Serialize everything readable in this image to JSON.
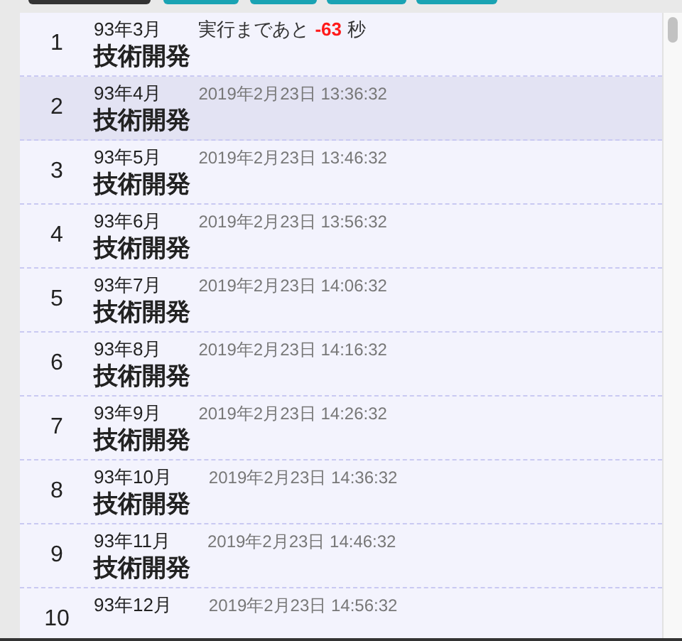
{
  "top_buttons": [
    {
      "color": "#333333"
    },
    {
      "color": "#1aa3b3"
    },
    {
      "color": "#1aa3b3"
    },
    {
      "color": "#1aa3b3"
    },
    {
      "color": "#1aa3b3"
    }
  ],
  "rows": [
    {
      "number": "1",
      "month": "93年3月",
      "kind": "countdown",
      "prefix": "実行まであと",
      "value": "-63",
      "suffix": "秒",
      "title": "技術開発",
      "selected": false
    },
    {
      "number": "2",
      "month": "93年4月",
      "kind": "date",
      "time": "2019年2月23日 13:36:32",
      "title": "技術開発",
      "selected": true
    },
    {
      "number": "3",
      "month": "93年5月",
      "kind": "date",
      "time": "2019年2月23日 13:46:32",
      "title": "技術開発",
      "selected": false
    },
    {
      "number": "4",
      "month": "93年6月",
      "kind": "date",
      "time": "2019年2月23日 13:56:32",
      "title": "技術開発",
      "selected": false
    },
    {
      "number": "5",
      "month": "93年7月",
      "kind": "date",
      "time": "2019年2月23日 14:06:32",
      "title": "技術開発",
      "selected": false
    },
    {
      "number": "6",
      "month": "93年8月",
      "kind": "date",
      "time": "2019年2月23日 14:16:32",
      "title": "技術開発",
      "selected": false
    },
    {
      "number": "7",
      "month": "93年9月",
      "kind": "date",
      "time": "2019年2月23日 14:26:32",
      "title": "技術開発",
      "selected": false
    },
    {
      "number": "8",
      "month": "93年10月",
      "kind": "date",
      "time": "2019年2月23日 14:36:32",
      "title": "技術開発",
      "selected": false
    },
    {
      "number": "9",
      "month": "93年11月",
      "kind": "date",
      "time": "2019年2月23日 14:46:32",
      "title": "技術開発",
      "selected": false
    },
    {
      "number": "10",
      "month": "93年12月",
      "kind": "date",
      "time": "2019年2月23日 14:56:32",
      "selected": false
    }
  ]
}
